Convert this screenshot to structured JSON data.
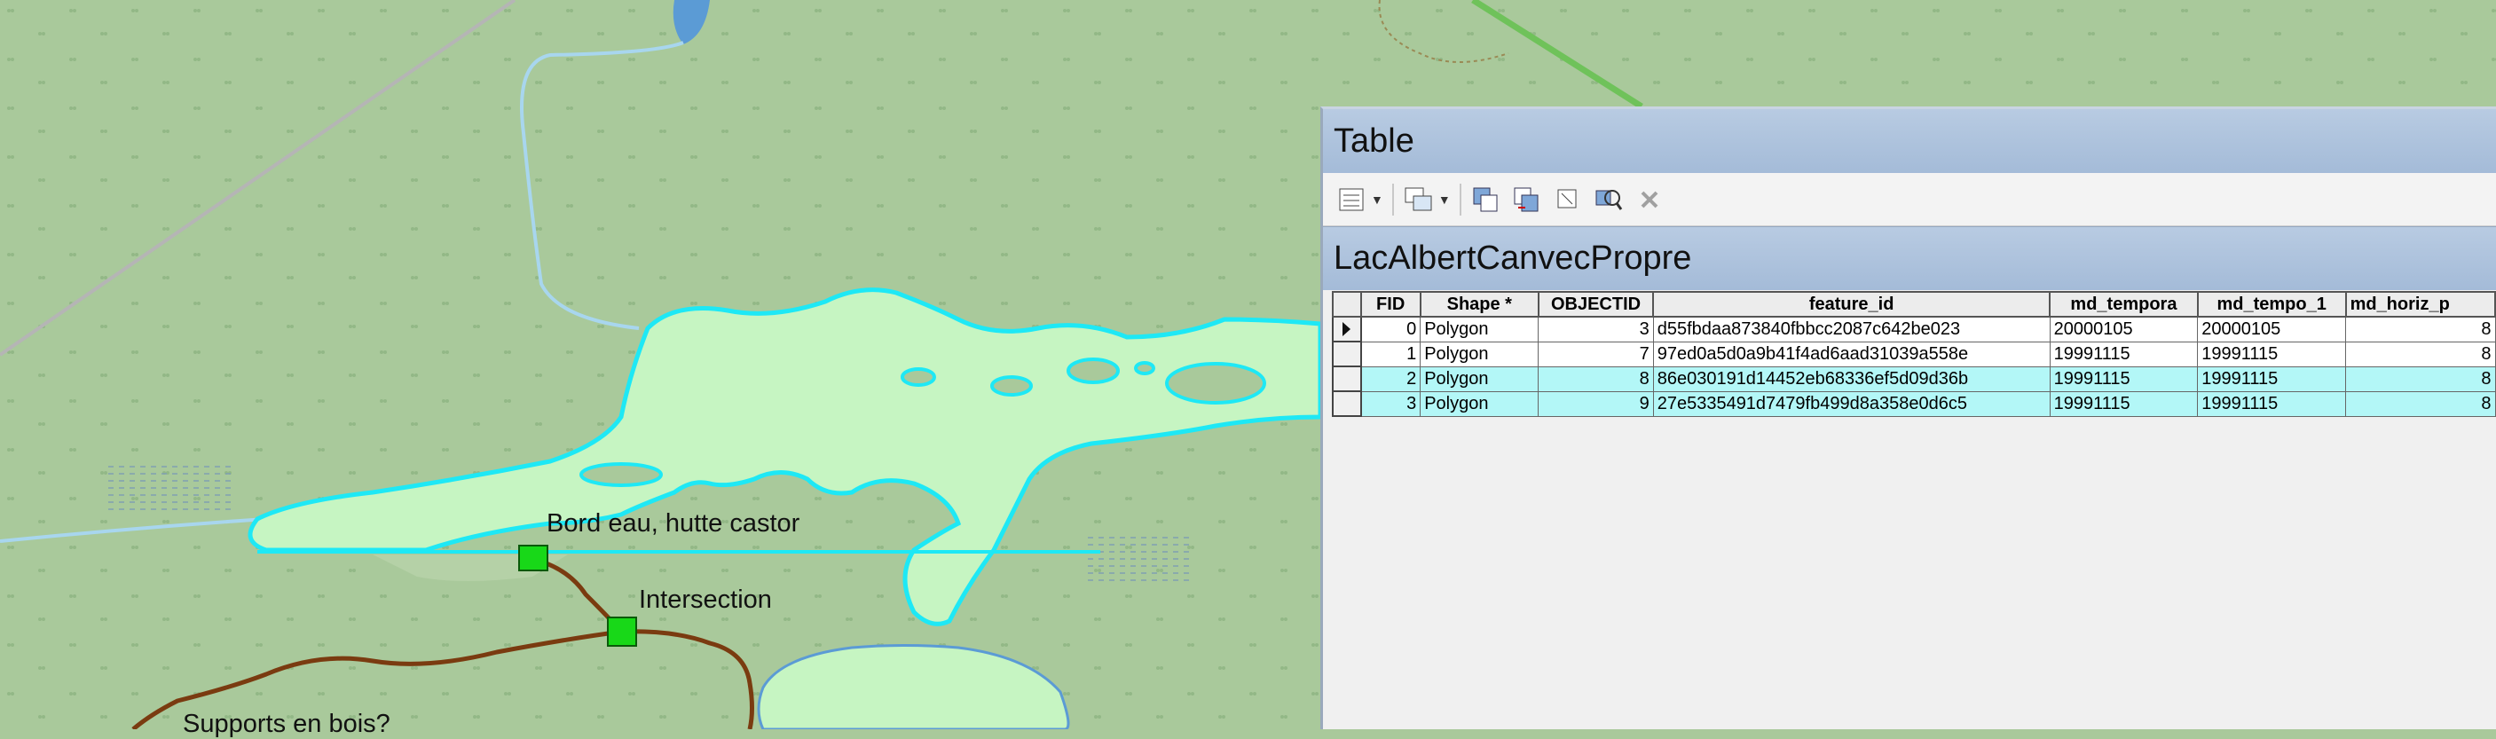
{
  "map": {
    "labels": {
      "bord_eau": "Bord eau, hutte castor",
      "intersection": "Intersection",
      "supports": "Supports en bois?"
    },
    "colors": {
      "background": "#a9c99b",
      "water_fill": "#c6f5c2",
      "selection_outline": "#1ee8f5",
      "trail": "#7a3b10",
      "point": "#18d818"
    }
  },
  "table_window": {
    "title": "Table",
    "layer_tab": "LacAlbertCanvecPropre",
    "toolbar": {
      "table_options": "table-options-icon",
      "related_tables": "related-tables-icon",
      "select_by_attributes": "select-by-attributes-icon",
      "switch_selection": "switch-selection-icon",
      "clear_selection": "clear-selection-icon",
      "zoom_to_selected": "zoom-to-selected-icon",
      "delete_selected": "delete-icon"
    },
    "columns": [
      "FID",
      "Shape *",
      "OBJECTID",
      "feature_id",
      "md_tempora",
      "md_tempo_1",
      "md_horiz_p"
    ],
    "rows": [
      {
        "fid": "0",
        "shape": "Polygon",
        "objectid": "3",
        "feature_id": "d55fbdaa873840fbbcc2087c642be023",
        "md_tempora": "20000105",
        "md_tempo_1": "20000105",
        "md_horiz_p": "8",
        "highlighted": false
      },
      {
        "fid": "1",
        "shape": "Polygon",
        "objectid": "7",
        "feature_id": "97ed0a5d0a9b41f4ad6aad31039a558e",
        "md_tempora": "19991115",
        "md_tempo_1": "19991115",
        "md_horiz_p": "8",
        "highlighted": false
      },
      {
        "fid": "2",
        "shape": "Polygon",
        "objectid": "8",
        "feature_id": "86e030191d14452eb68336ef5d09d36b",
        "md_tempora": "19991115",
        "md_tempo_1": "19991115",
        "md_horiz_p": "8",
        "highlighted": true
      },
      {
        "fid": "3",
        "shape": "Polygon",
        "objectid": "9",
        "feature_id": "27e5335491d7479fb499d8a358e0d6c5",
        "md_tempora": "19991115",
        "md_tempo_1": "19991115",
        "md_horiz_p": "8",
        "highlighted": true
      }
    ],
    "highlight_color": "#b3f7f7"
  }
}
